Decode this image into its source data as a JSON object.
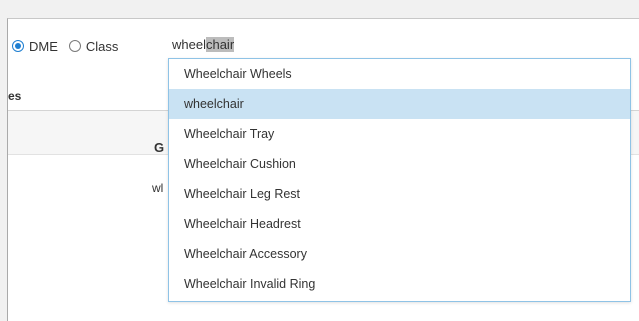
{
  "search_type": {
    "options": [
      {
        "label": "DME",
        "checked": true
      },
      {
        "label": "Class",
        "checked": false
      }
    ]
  },
  "search": {
    "typed": "wheel",
    "autocomplete": "chair"
  },
  "table": {
    "header_fragment": "es",
    "column_header_fragment": "G",
    "cell_fragment": "wl"
  },
  "suggestions": {
    "highlighted_index": 1,
    "items": [
      "Wheelchair Wheels",
      "wheelchair",
      "Wheelchair Tray",
      "Wheelchair Cushion",
      "Wheelchair Leg Rest",
      "Wheelchair Headrest",
      "Wheelchair Accessory",
      "Wheelchair Invalid Ring"
    ]
  },
  "colors": {
    "accent": "#1f7fd1",
    "dropdown_border": "#8fc3e6",
    "highlight": "#c9e2f3"
  }
}
